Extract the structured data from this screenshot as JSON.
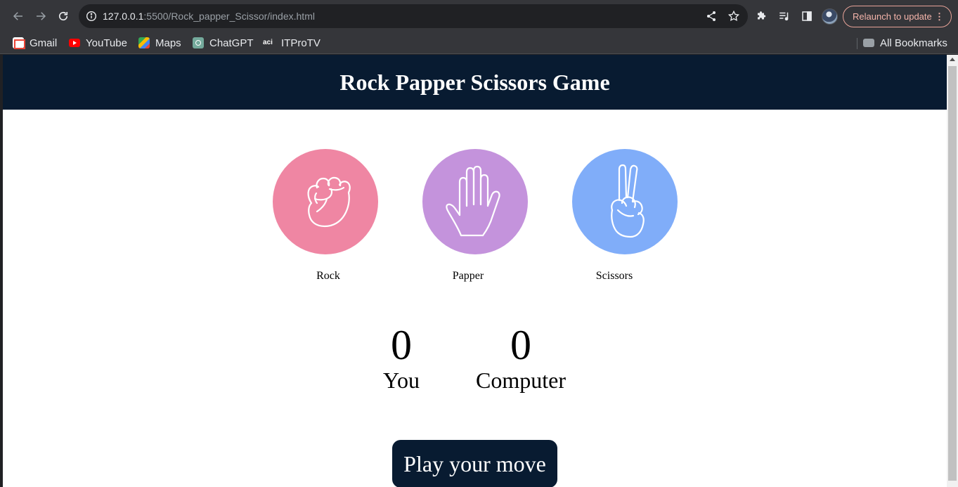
{
  "browser": {
    "url_host": "127.0.0.1",
    "url_path": ":5500/Rock_papper_Scissor/index.html",
    "relaunch_label": "Relaunch to update",
    "bookmarks": [
      {
        "label": "Gmail",
        "icon": "gmail-icon"
      },
      {
        "label": "YouTube",
        "icon": "youtube-icon"
      },
      {
        "label": "Maps",
        "icon": "maps-icon"
      },
      {
        "label": "ChatGPT",
        "icon": "chatgpt-icon"
      },
      {
        "label": "ITProTV",
        "icon": "itprotv-icon"
      }
    ],
    "all_bookmarks_label": "All Bookmarks",
    "itpro_icon_text": "aci"
  },
  "page": {
    "title": "Rock Papper Scissors Game",
    "header_color": "#081b31",
    "choices": [
      {
        "label": "Rock",
        "icon": "rock-fist-icon",
        "color": "#ef86a3"
      },
      {
        "label": "Papper",
        "icon": "paper-hand-icon",
        "color": "#c493dc"
      },
      {
        "label": "Scissors",
        "icon": "scissors-hand-icon",
        "color": "#80adf9"
      }
    ],
    "score": {
      "user_score": "0",
      "user_label": "You",
      "computer_score": "0",
      "computer_label": "Computer"
    },
    "message": "Play your move"
  }
}
